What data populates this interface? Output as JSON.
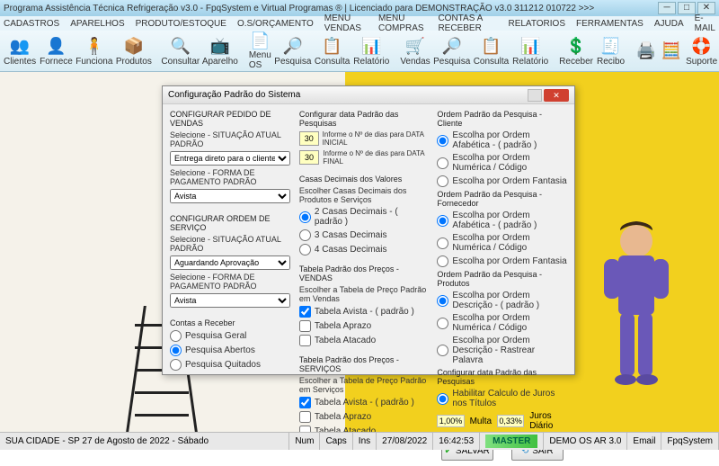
{
  "window": {
    "title": "Programa Assistência Técnica Refrigeração v3.0 - FpqSystem e Virtual Programas ® | Licenciado para DEMONSTRAÇÃO v3.0 311212 010722 >>>"
  },
  "menu": [
    "CADASTROS",
    "APARELHOS",
    "PRODUTO/ESTOQUE",
    "O.S/ORÇAMENTO",
    "MENU VENDAS",
    "MENU COMPRAS",
    "CONTAS A RECEBER",
    "RELATORIOS",
    "FERRAMENTAS",
    "AJUDA",
    "E-MAIL"
  ],
  "ribbon": [
    {
      "label": "Clientes",
      "icon": "👥"
    },
    {
      "label": "Fornece",
      "icon": "👤"
    },
    {
      "label": "Funciona",
      "icon": "🧍"
    },
    {
      "label": "Produtos",
      "icon": "📦",
      "sep": true
    },
    {
      "label": "Consultar",
      "icon": "🔍"
    },
    {
      "label": "Aparelho",
      "icon": "📺",
      "sep": true
    },
    {
      "label": "Menu OS",
      "icon": "📄"
    },
    {
      "label": "Pesquisa",
      "icon": "🔎"
    },
    {
      "label": "Consulta",
      "icon": "📋"
    },
    {
      "label": "Relatório",
      "icon": "📊",
      "sep": true
    },
    {
      "label": "Vendas",
      "icon": "🛒"
    },
    {
      "label": "Pesquisa",
      "icon": "🔎"
    },
    {
      "label": "Consulta",
      "icon": "📋"
    },
    {
      "label": "Relatório",
      "icon": "📊",
      "sep": true
    },
    {
      "label": "Receber",
      "icon": "💲"
    },
    {
      "label": "Recibo",
      "icon": "🧾",
      "sep": true
    },
    {
      "label": "",
      "icon": "🖨️"
    },
    {
      "label": "",
      "icon": "🧮"
    },
    {
      "label": "Suporte",
      "icon": "🛟"
    },
    {
      "label": "",
      "icon": "📕"
    }
  ],
  "dialog": {
    "title": "Configuração Padrão do Sistema",
    "col1": {
      "h1": "CONFIGURAR PEDIDO DE VENDAS",
      "l1": "Selecione - SITUAÇÃO ATUAL PADRÃO",
      "s1": "Entrega direto para o cliente",
      "l2": "Selecione - FORMA DE PAGAMENTO PADRÃO",
      "s2": "Avista",
      "h2": "CONFIGURAR ORDEM DE SERVIÇO",
      "l3": "Selecione - SITUAÇÃO ATUAL PADRÃO",
      "s3": "Aguardando Aprovação",
      "l4": "Selecione - FORMA DE PAGAMENTO PADRÃO",
      "s4": "Avista",
      "h3": "Contas a Receber",
      "r1": "Pesquisa Geral",
      "r2": "Pesquisa Abertos",
      "r3": "Pesquisa Quitados"
    },
    "col2": {
      "h1": "Configurar data Padrão das Pesquisas",
      "n1": "30",
      "nl1": "Informe o Nº de dias para DATA INICIAL",
      "n2": "30",
      "nl2": "Informe o Nº de dias para DATA FINAL",
      "h2": "Casas Decimais dos Valores",
      "l2": "Escolher Casas Decimais dos Produtos e Serviços",
      "r1": "2 Casas Decimais - ( padrão )",
      "r2": "3 Casas Decimais",
      "r3": "4 Casas Decimais",
      "h3": "Tabela Padrão dos Preços - VENDAS",
      "l3": "Escolher a Tabela de Preço Padrão em Vendas",
      "c1": "Tabela Avista - ( padrão )",
      "c2": "Tabela Aprazo",
      "c3": "Tabela Atacado",
      "h4": "Tabela Padrão dos Preços - SERVIÇOS",
      "l4": "Escolher a Tabela de Preço Padrão em Serviços",
      "c4": "Tabela Avista - ( padrão )",
      "c5": "Tabela Aprazo",
      "c6": "Tabela Atacado"
    },
    "col3": {
      "h1": "Ordem Padrão da Pesquisa - Cliente",
      "r1": "Escolha por Ordem Afabética - ( padrão )",
      "r2": "Escolha por Ordem Numérica / Código",
      "r3": "Escolha por Ordem Fantasia",
      "h2": "Ordem Padrão da Pesquisa - Fornecedor",
      "r4": "Escolha por Ordem Afabética - ( padrão )",
      "r5": "Escolha por Ordem Numérica / Código",
      "r6": "Escolha por Ordem Fantasia",
      "h3": "Ordem Padrão da Pesquisa - Produtos",
      "r7": "Escolha por Ordem Descrição - ( padrão )",
      "r8": "Escolha por Ordem Numérica / Código",
      "r9": "Escolha por Ordem Descrição - Rastrear Palavra",
      "h4": "Configurar data Padrão das Pesquisas",
      "r10": "Habilitar Calculo de Juros nos Títulos",
      "p1": "1,00%",
      "pl1": "Multa",
      "p2": "0,33%",
      "pl2": "Juros Diário",
      "btn1": "SALVAR",
      "btn2": "SAIR"
    }
  },
  "status": {
    "left": "SUA CIDADE - SP 27 de Agosto de 2022 - Sábado",
    "num": "Num",
    "caps": "Caps",
    "ins": "Ins",
    "date": "27/08/2022",
    "time": "16:42:53",
    "master": "MASTER",
    "demo": "DEMO OS AR 3.0",
    "email": "Email",
    "fpq": "FpqSystem"
  }
}
